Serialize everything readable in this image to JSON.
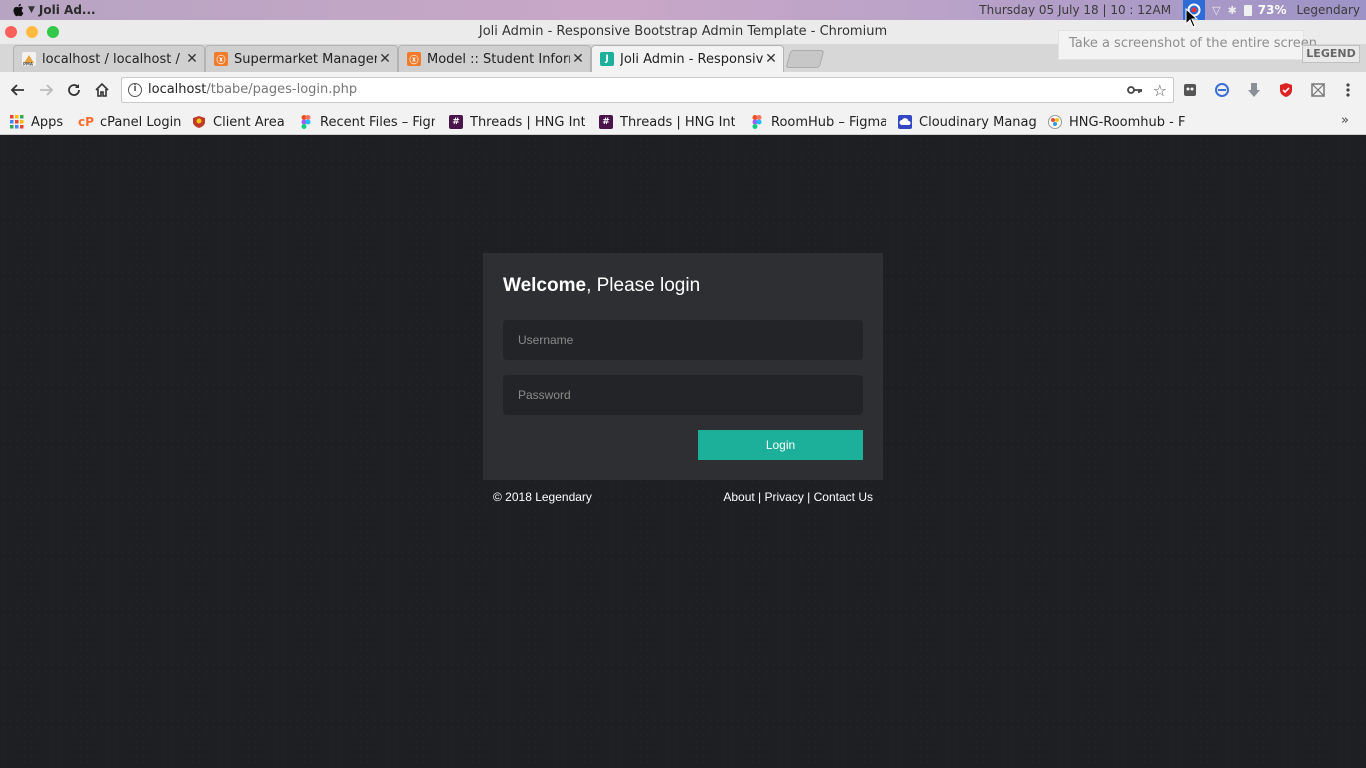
{
  "os_bar": {
    "app_name": "Joli Ad...",
    "clock": "Thursday 05 July 18 | 10 : 12AM",
    "battery_percent": "73%",
    "user": "Legendary"
  },
  "window": {
    "title": "Joli Admin - Responsive Bootstrap Admin Template - Chromium",
    "tooltip": "Take a screenshot of the entire screen",
    "overlay_badge": "LEGEND"
  },
  "tabs": [
    {
      "title": "localhost / localhost / tl",
      "favicon": "pma-icon",
      "active": false
    },
    {
      "title": "Supermarket Managem",
      "favicon": "xampp-icon",
      "active": false
    },
    {
      "title": "Model :: Student Inform",
      "favicon": "xampp-icon",
      "active": false
    },
    {
      "title": "Joli Admin - Responsiv",
      "favicon": "joli-icon",
      "active": true
    }
  ],
  "address_bar": {
    "host": "localhost",
    "path": "/tbabe/pages-login.php"
  },
  "bookmarks": [
    {
      "label": "Apps",
      "icon": "apps-grid-icon"
    },
    {
      "label": "cPanel Login",
      "icon": "cpanel-icon"
    },
    {
      "label": "Client Area",
      "icon": "client-area-icon"
    },
    {
      "label": "Recent Files – Figm",
      "icon": "figma-icon"
    },
    {
      "label": "Threads | HNG Inte",
      "icon": "slack-icon"
    },
    {
      "label": "Threads | HNG Inte",
      "icon": "slack-icon"
    },
    {
      "label": "RoomHub – Figma",
      "icon": "figma-icon"
    },
    {
      "label": "Cloudinary Manag",
      "icon": "cloudinary-icon"
    },
    {
      "label": "HNG-Roomhub - F",
      "icon": "roomhub-icon"
    }
  ],
  "bookmarks_more": "»",
  "login": {
    "title_bold": "Welcome",
    "title_rest": ", Please login",
    "username_placeholder": "Username",
    "password_placeholder": "Password",
    "button": "Login"
  },
  "footer": {
    "copyright": "© 2018 Legendary",
    "links": [
      "About",
      "Privacy",
      "Contact Us"
    ],
    "separator": " | "
  },
  "colors": {
    "accent": "#1caf9a",
    "page_bg": "#1e1f23",
    "panel_bg": "#2e2f33"
  }
}
